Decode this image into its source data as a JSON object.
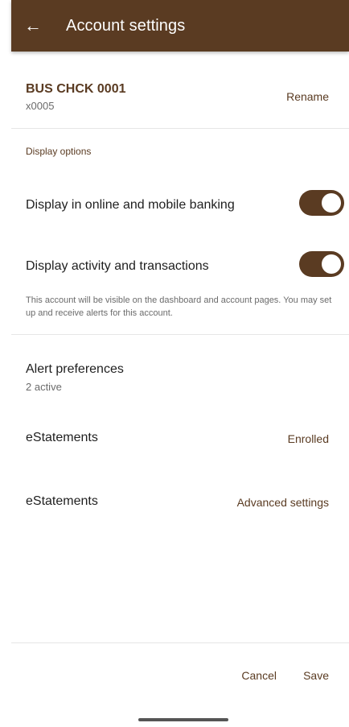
{
  "app_bar": {
    "back_icon": "←",
    "title": "Account settings"
  },
  "account": {
    "name": "BUS CHCK 0001",
    "number": "x0005",
    "rename_label": "Rename"
  },
  "display_options": {
    "section_label": "Display options",
    "toggles": [
      {
        "label": "Display in online and mobile banking",
        "on": true
      },
      {
        "label": "Display activity and transactions",
        "on": true
      }
    ],
    "helper_text": "This account will be visible on the dashboard and account pages. You may set up and receive alerts for this account."
  },
  "alerts": {
    "title": "Alert preferences",
    "subtitle": "2 active"
  },
  "estatements": [
    {
      "label": "eStatements",
      "action": "Enrolled"
    },
    {
      "label": "eStatements",
      "action": "Advanced settings"
    }
  ],
  "footer": {
    "cancel_label": "Cancel",
    "save_label": "Save"
  },
  "colors": {
    "brand": "#5a3b22"
  }
}
